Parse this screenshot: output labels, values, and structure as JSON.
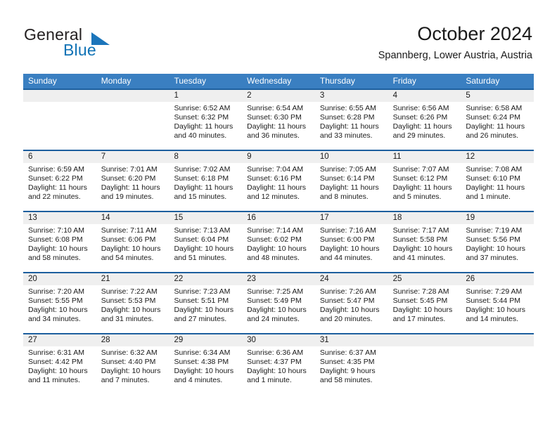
{
  "brand": {
    "word1": "General",
    "word2": "Blue",
    "accent_color": "#1b75bb",
    "logo_icon": "triangle-logo-icon"
  },
  "header": {
    "title": "October 2024",
    "subtitle": "Spannberg, Lower Austria, Austria"
  },
  "theme": {
    "header_blue": "#3a7fc1",
    "row_border_blue": "#1d5f9e",
    "daynum_band": "#efefef"
  },
  "weekdays": [
    "Sunday",
    "Monday",
    "Tuesday",
    "Wednesday",
    "Thursday",
    "Friday",
    "Saturday"
  ],
  "weeks": [
    [
      {
        "day": "",
        "sunrise": "",
        "sunset": "",
        "daylight": "",
        "empty": true
      },
      {
        "day": "",
        "sunrise": "",
        "sunset": "",
        "daylight": "",
        "empty": true
      },
      {
        "day": "1",
        "sunrise": "Sunrise: 6:52 AM",
        "sunset": "Sunset: 6:32 PM",
        "daylight": "Daylight: 11 hours and 40 minutes."
      },
      {
        "day": "2",
        "sunrise": "Sunrise: 6:54 AM",
        "sunset": "Sunset: 6:30 PM",
        "daylight": "Daylight: 11 hours and 36 minutes."
      },
      {
        "day": "3",
        "sunrise": "Sunrise: 6:55 AM",
        "sunset": "Sunset: 6:28 PM",
        "daylight": "Daylight: 11 hours and 33 minutes."
      },
      {
        "day": "4",
        "sunrise": "Sunrise: 6:56 AM",
        "sunset": "Sunset: 6:26 PM",
        "daylight": "Daylight: 11 hours and 29 minutes."
      },
      {
        "day": "5",
        "sunrise": "Sunrise: 6:58 AM",
        "sunset": "Sunset: 6:24 PM",
        "daylight": "Daylight: 11 hours and 26 minutes."
      }
    ],
    [
      {
        "day": "6",
        "sunrise": "Sunrise: 6:59 AM",
        "sunset": "Sunset: 6:22 PM",
        "daylight": "Daylight: 11 hours and 22 minutes."
      },
      {
        "day": "7",
        "sunrise": "Sunrise: 7:01 AM",
        "sunset": "Sunset: 6:20 PM",
        "daylight": "Daylight: 11 hours and 19 minutes."
      },
      {
        "day": "8",
        "sunrise": "Sunrise: 7:02 AM",
        "sunset": "Sunset: 6:18 PM",
        "daylight": "Daylight: 11 hours and 15 minutes."
      },
      {
        "day": "9",
        "sunrise": "Sunrise: 7:04 AM",
        "sunset": "Sunset: 6:16 PM",
        "daylight": "Daylight: 11 hours and 12 minutes."
      },
      {
        "day": "10",
        "sunrise": "Sunrise: 7:05 AM",
        "sunset": "Sunset: 6:14 PM",
        "daylight": "Daylight: 11 hours and 8 minutes."
      },
      {
        "day": "11",
        "sunrise": "Sunrise: 7:07 AM",
        "sunset": "Sunset: 6:12 PM",
        "daylight": "Daylight: 11 hours and 5 minutes."
      },
      {
        "day": "12",
        "sunrise": "Sunrise: 7:08 AM",
        "sunset": "Sunset: 6:10 PM",
        "daylight": "Daylight: 11 hours and 1 minute."
      }
    ],
    [
      {
        "day": "13",
        "sunrise": "Sunrise: 7:10 AM",
        "sunset": "Sunset: 6:08 PM",
        "daylight": "Daylight: 10 hours and 58 minutes."
      },
      {
        "day": "14",
        "sunrise": "Sunrise: 7:11 AM",
        "sunset": "Sunset: 6:06 PM",
        "daylight": "Daylight: 10 hours and 54 minutes."
      },
      {
        "day": "15",
        "sunrise": "Sunrise: 7:13 AM",
        "sunset": "Sunset: 6:04 PM",
        "daylight": "Daylight: 10 hours and 51 minutes."
      },
      {
        "day": "16",
        "sunrise": "Sunrise: 7:14 AM",
        "sunset": "Sunset: 6:02 PM",
        "daylight": "Daylight: 10 hours and 48 minutes."
      },
      {
        "day": "17",
        "sunrise": "Sunrise: 7:16 AM",
        "sunset": "Sunset: 6:00 PM",
        "daylight": "Daylight: 10 hours and 44 minutes."
      },
      {
        "day": "18",
        "sunrise": "Sunrise: 7:17 AM",
        "sunset": "Sunset: 5:58 PM",
        "daylight": "Daylight: 10 hours and 41 minutes."
      },
      {
        "day": "19",
        "sunrise": "Sunrise: 7:19 AM",
        "sunset": "Sunset: 5:56 PM",
        "daylight": "Daylight: 10 hours and 37 minutes."
      }
    ],
    [
      {
        "day": "20",
        "sunrise": "Sunrise: 7:20 AM",
        "sunset": "Sunset: 5:55 PM",
        "daylight": "Daylight: 10 hours and 34 minutes."
      },
      {
        "day": "21",
        "sunrise": "Sunrise: 7:22 AM",
        "sunset": "Sunset: 5:53 PM",
        "daylight": "Daylight: 10 hours and 31 minutes."
      },
      {
        "day": "22",
        "sunrise": "Sunrise: 7:23 AM",
        "sunset": "Sunset: 5:51 PM",
        "daylight": "Daylight: 10 hours and 27 minutes."
      },
      {
        "day": "23",
        "sunrise": "Sunrise: 7:25 AM",
        "sunset": "Sunset: 5:49 PM",
        "daylight": "Daylight: 10 hours and 24 minutes."
      },
      {
        "day": "24",
        "sunrise": "Sunrise: 7:26 AM",
        "sunset": "Sunset: 5:47 PM",
        "daylight": "Daylight: 10 hours and 20 minutes."
      },
      {
        "day": "25",
        "sunrise": "Sunrise: 7:28 AM",
        "sunset": "Sunset: 5:45 PM",
        "daylight": "Daylight: 10 hours and 17 minutes."
      },
      {
        "day": "26",
        "sunrise": "Sunrise: 7:29 AM",
        "sunset": "Sunset: 5:44 PM",
        "daylight": "Daylight: 10 hours and 14 minutes."
      }
    ],
    [
      {
        "day": "27",
        "sunrise": "Sunrise: 6:31 AM",
        "sunset": "Sunset: 4:42 PM",
        "daylight": "Daylight: 10 hours and 11 minutes."
      },
      {
        "day": "28",
        "sunrise": "Sunrise: 6:32 AM",
        "sunset": "Sunset: 4:40 PM",
        "daylight": "Daylight: 10 hours and 7 minutes."
      },
      {
        "day": "29",
        "sunrise": "Sunrise: 6:34 AM",
        "sunset": "Sunset: 4:38 PM",
        "daylight": "Daylight: 10 hours and 4 minutes."
      },
      {
        "day": "30",
        "sunrise": "Sunrise: 6:36 AM",
        "sunset": "Sunset: 4:37 PM",
        "daylight": "Daylight: 10 hours and 1 minute."
      },
      {
        "day": "31",
        "sunrise": "Sunrise: 6:37 AM",
        "sunset": "Sunset: 4:35 PM",
        "daylight": "Daylight: 9 hours and 58 minutes."
      },
      {
        "day": "",
        "sunrise": "",
        "sunset": "",
        "daylight": "",
        "empty": true
      },
      {
        "day": "",
        "sunrise": "",
        "sunset": "",
        "daylight": "",
        "empty": true
      }
    ]
  ]
}
